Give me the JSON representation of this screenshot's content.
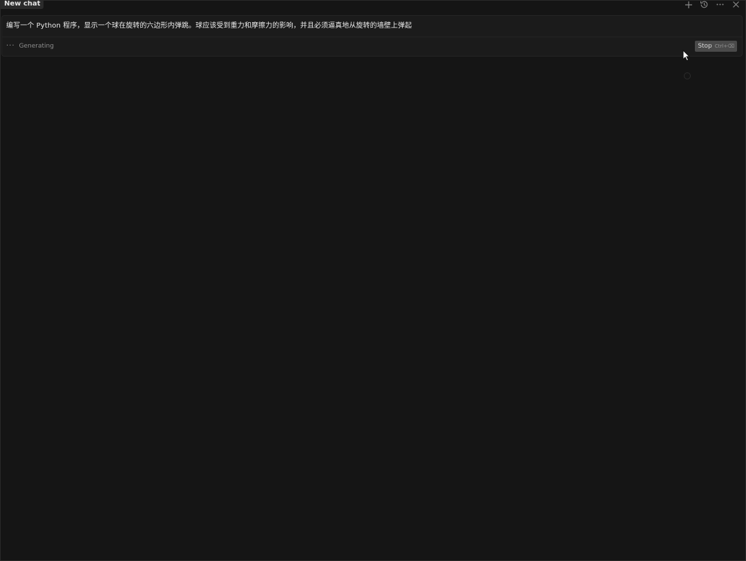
{
  "tab": {
    "title": "New chat"
  },
  "toolbar": {
    "icons": [
      "plus-icon",
      "history-icon",
      "more-icon",
      "close-icon"
    ]
  },
  "message": {
    "prompt": "编写一个 Python 程序，显示一个球在旋转的六边形内弹跳。球应该受到重力和摩擦力的影响，并且必须逼真地从旋转的墙壁上弹起"
  },
  "status": {
    "dots": "···",
    "text": "Generating"
  },
  "stop_button": {
    "label": "Stop",
    "shortcut": "Ctrl+⌫"
  },
  "colors": {
    "background": "#151515",
    "card": "#1b1b1b",
    "stop_button": "#4a4a4a"
  }
}
